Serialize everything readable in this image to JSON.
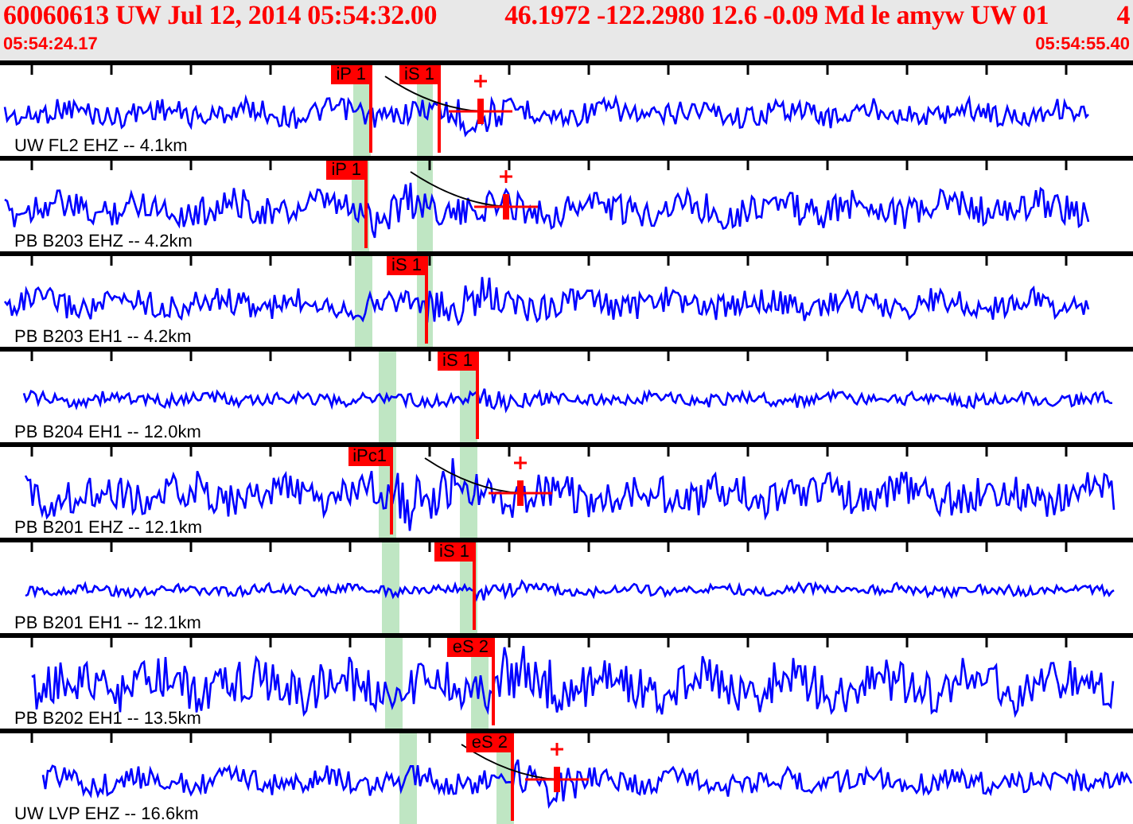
{
  "header": {
    "event": "60060613 UW Jul 12, 2014 05:54:32.00",
    "solution": "46.1972 -122.2980 12.6 -0.09 Md le amyw UW 01",
    "count": "4",
    "start_time": "05:54:24.17",
    "end_time": "05:54:55.40"
  },
  "traces": [
    {
      "label": "UW FL2 EHZ -- 4.1km",
      "picks": [
        {
          "label": "iP 1"
        },
        {
          "label": "iS 1"
        }
      ]
    },
    {
      "label": "PB B203 EHZ -- 4.2km",
      "picks": [
        {
          "label": "iP 1"
        }
      ]
    },
    {
      "label": "PB B203 EH1 -- 4.2km",
      "picks": [
        {
          "label": "iS 1"
        }
      ]
    },
    {
      "label": "PB B204 EH1 -- 12.0km",
      "picks": [
        {
          "label": "iS 1"
        }
      ]
    },
    {
      "label": "PB B201 EHZ -- 12.1km",
      "picks": [
        {
          "label": "iPc1"
        }
      ]
    },
    {
      "label": "PB B201 EH1 -- 12.1km",
      "picks": [
        {
          "label": "iS 1"
        }
      ]
    },
    {
      "label": "PB B202 EH1 -- 13.5km",
      "picks": [
        {
          "label": "eS 2"
        }
      ]
    },
    {
      "label": "UW LVP EHZ -- 16.6km",
      "picks": [
        {
          "label": "eS 2"
        }
      ]
    }
  ]
}
